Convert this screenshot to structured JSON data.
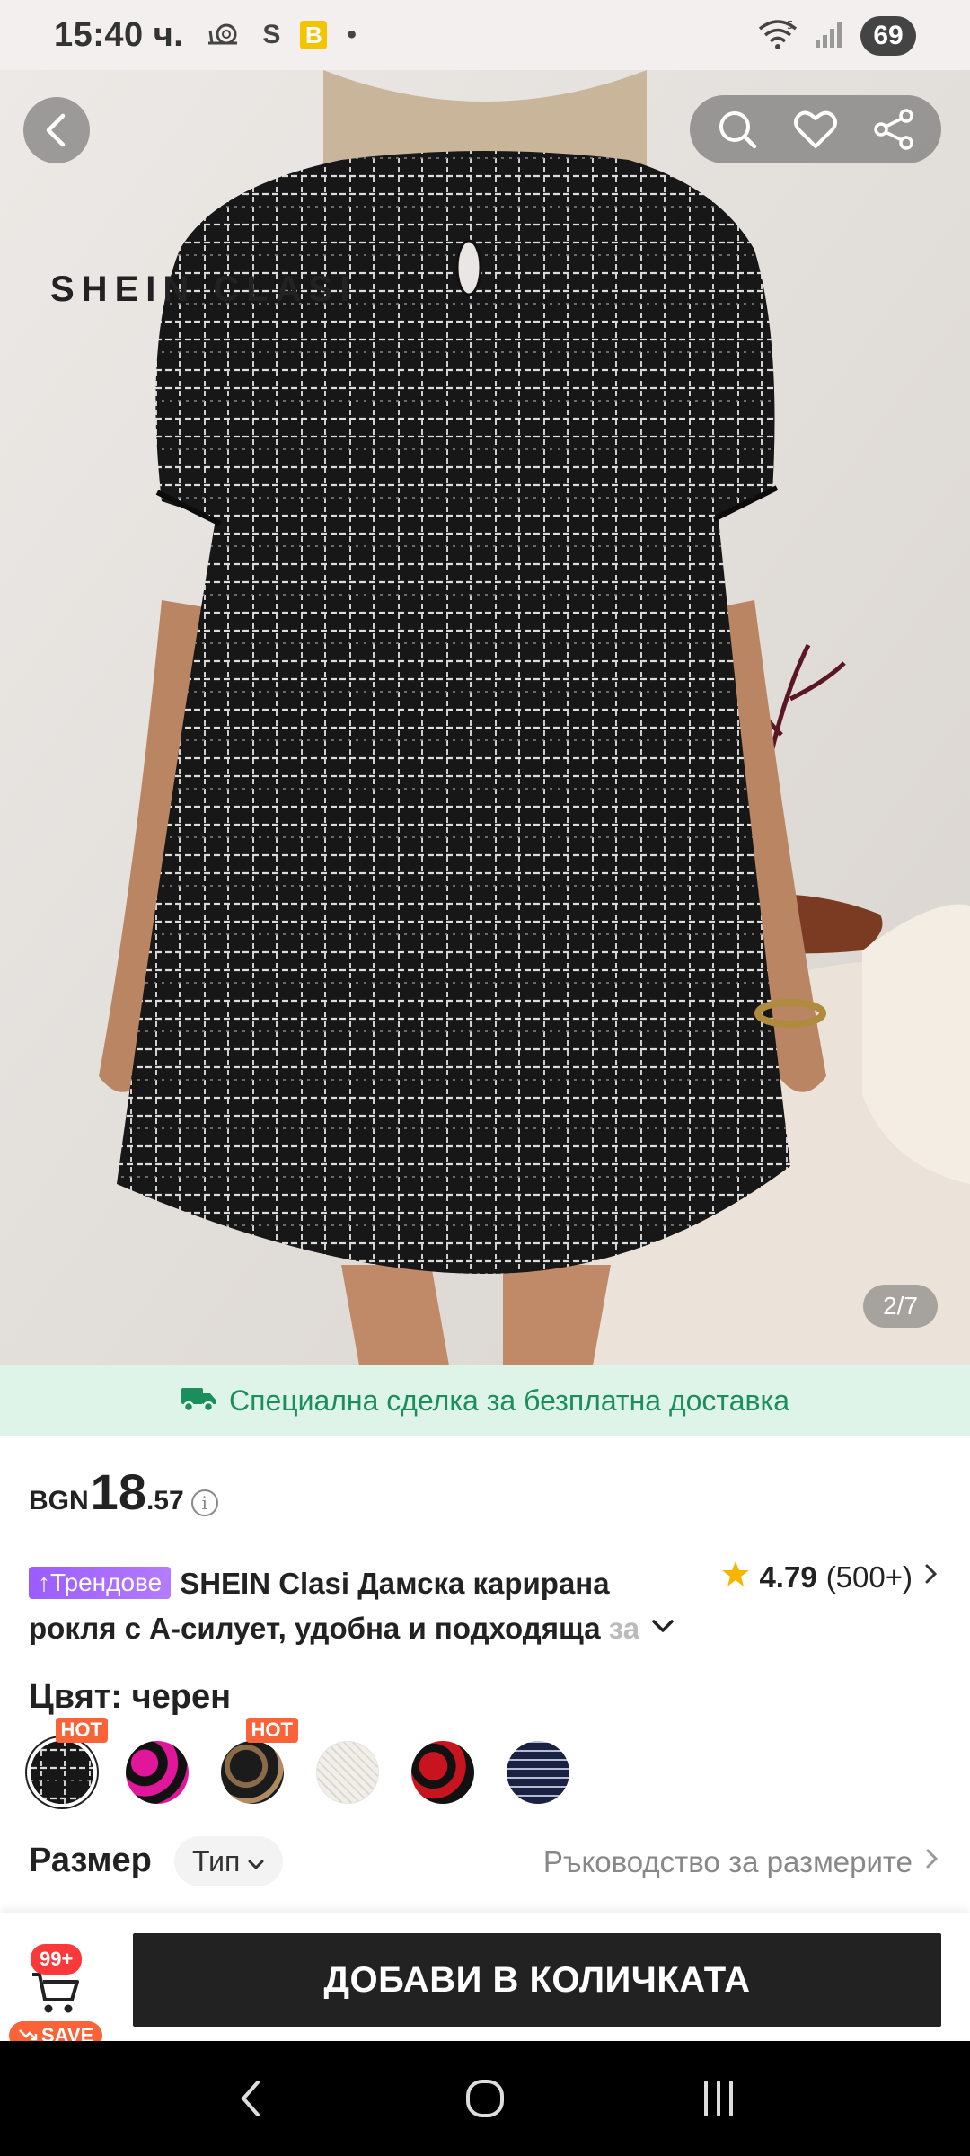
{
  "status_bar": {
    "time": "15:40 ч.",
    "wifi_generation": "5",
    "battery": "69",
    "sim_label": "S",
    "b_badge": "B",
    "dot": "•"
  },
  "hero": {
    "brand_watermark": "SHEIN CLASI",
    "page_indicator": "2/7",
    "icons": [
      "back-arrow-icon",
      "search-icon",
      "heart-icon",
      "share-icon"
    ]
  },
  "shipping_banner": {
    "text": "Специална сделка за безплатна доставка",
    "icon": "truck-icon",
    "color": "#1a8f5c"
  },
  "price": {
    "currency": "BGN",
    "main": "18",
    "cents": ".57",
    "info_icon": "i"
  },
  "product": {
    "trend_badge": "Трендове",
    "title_line1": "SHEIN Clasi Дамска карирана",
    "title_line2": "рокля с А-силует, удобна и подходяща ",
    "title_fade": "за",
    "rating": "4.79",
    "rating_count": "(500+)"
  },
  "color": {
    "label": "Цвят: черен",
    "hot_label": "HOT",
    "swatches": [
      {
        "name": "black-white-plaid",
        "hot": true,
        "selected": true
      },
      {
        "name": "pink-black",
        "hot": false,
        "selected": false
      },
      {
        "name": "leopard",
        "hot": true,
        "selected": false
      },
      {
        "name": "white-tweed",
        "hot": false,
        "selected": false
      },
      {
        "name": "red-black",
        "hot": false,
        "selected": false
      },
      {
        "name": "navy-plaid",
        "hot": false,
        "selected": false
      }
    ]
  },
  "size": {
    "label": "Размер",
    "type_chip": "Тип",
    "guide": "Ръководство за размерите"
  },
  "action_bar": {
    "cart_count": "99+",
    "save_label": "SAVE",
    "add_to_cart": "ДОБАВИ В КОЛИЧКАТА"
  },
  "colors": {
    "accent": "#fa6338",
    "trend": "#9b5cff",
    "primary_button": "#222222",
    "banner_bg": "#dff4e9"
  }
}
